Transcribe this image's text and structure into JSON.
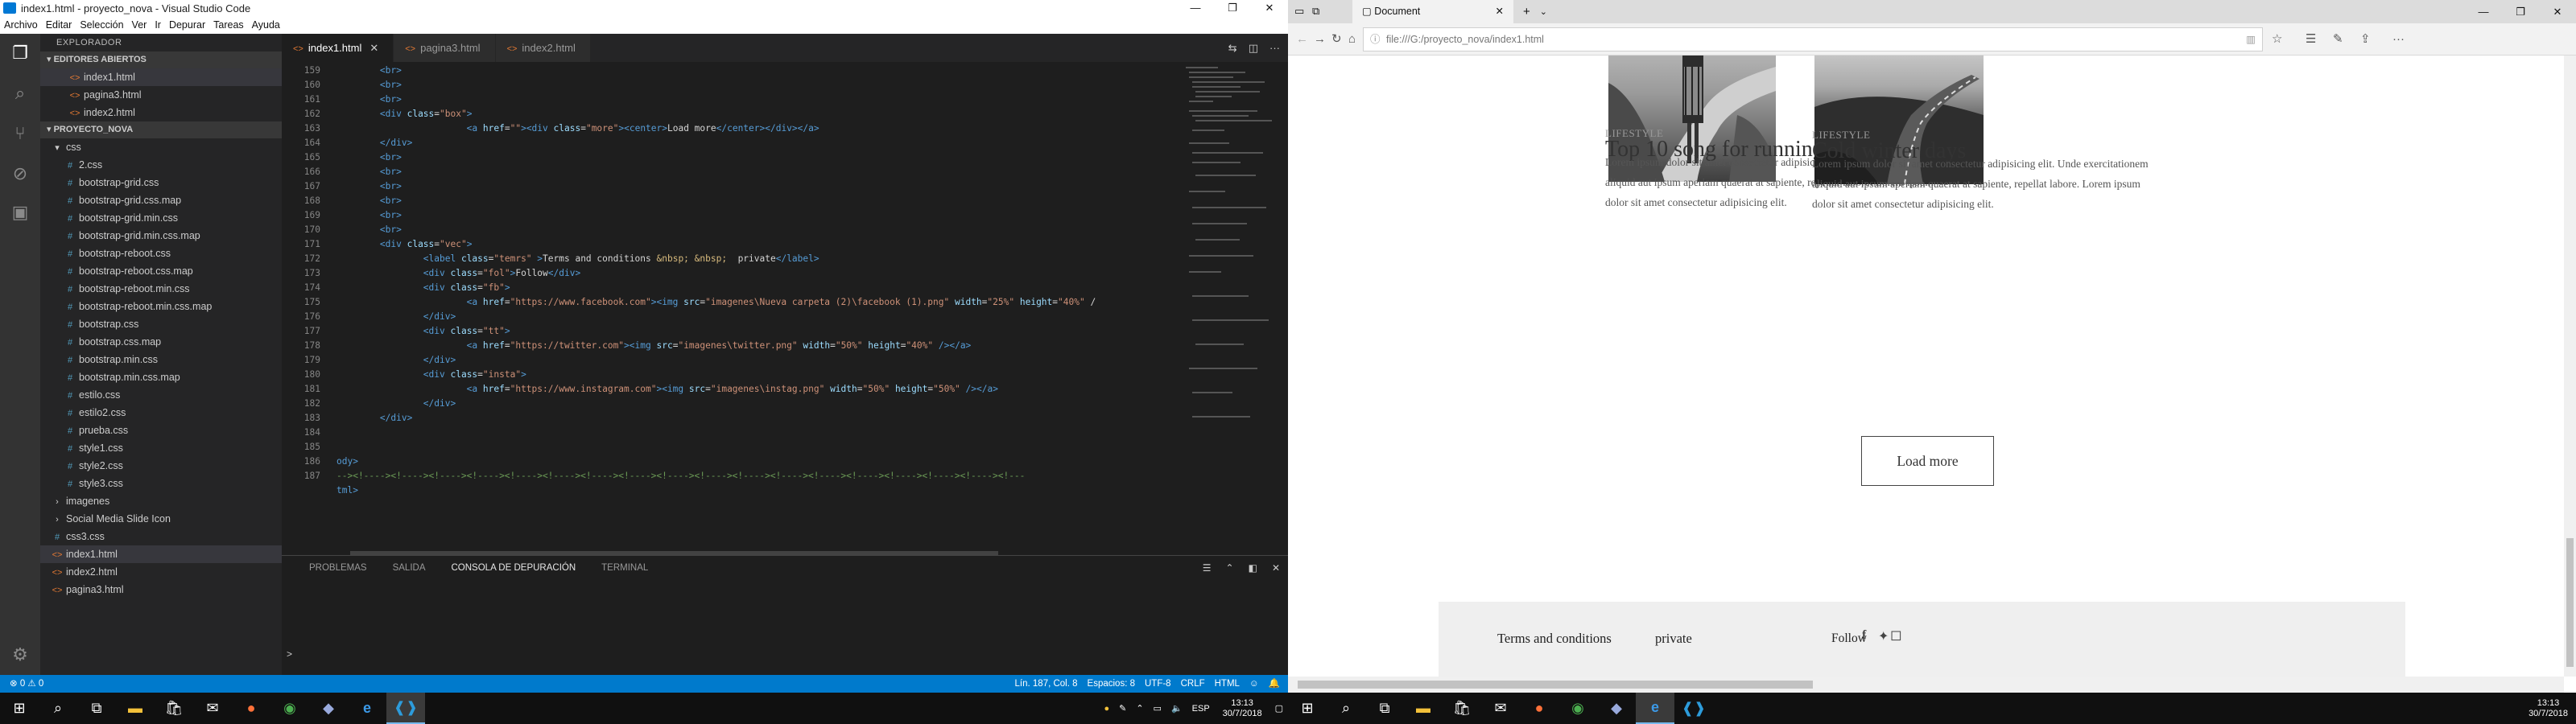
{
  "vscode": {
    "window_title": "index1.html - proyecto_nova - Visual Studio Code",
    "window_controls": {
      "minimize": "—",
      "maximize": "❐",
      "close": "✕"
    },
    "menu": [
      "Archivo",
      "Editar",
      "Selección",
      "Ver",
      "Ir",
      "Depurar",
      "Tareas",
      "Ayuda"
    ],
    "activity_icons": [
      "files-icon",
      "search-icon",
      "source-control-icon",
      "debug-icon",
      "extensions-icon",
      "gear-icon"
    ],
    "sidebar": {
      "title": "EXPLORADOR",
      "open_editors_label": "EDITORES ABIERTOS",
      "open_editors": [
        "index1.html",
        "pagina3.html",
        "index2.html"
      ],
      "project_label": "PROYECTO_NOVA",
      "css_folder": "css",
      "css_files": [
        "2.css",
        "bootstrap-grid.css",
        "bootstrap-grid.css.map",
        "bootstrap-grid.min.css",
        "bootstrap-grid.min.css.map",
        "bootstrap-reboot.css",
        "bootstrap-reboot.css.map",
        "bootstrap-reboot.min.css",
        "bootstrap-reboot.min.css.map",
        "bootstrap.css",
        "bootstrap.css.map",
        "bootstrap.min.css",
        "bootstrap.min.css.map",
        "estilo.css",
        "estilo2.css",
        "prueba.css",
        "style1.css",
        "style2.css",
        "style3.css"
      ],
      "folders": [
        "imagenes",
        "Social Media Slide Icon"
      ],
      "root_files": [
        "css3.css",
        "index1.html",
        "index2.html",
        "pagina3.html"
      ]
    },
    "tabs": [
      "index1.html",
      "pagina3.html",
      "index2.html"
    ],
    "line_numbers": [
      "159",
      "160",
      "161",
      "162",
      "163",
      "164",
      "165",
      "166",
      "167",
      "168",
      "169",
      "170",
      "171",
      "172",
      "173",
      "174",
      "175",
      "176",
      "177",
      "178",
      "179",
      "180",
      "181",
      "182",
      "183",
      "184",
      "185",
      "186",
      "187"
    ],
    "panel_tabs": [
      "PROBLEMAS",
      "SALIDA",
      "CONSOLA DE DEPURACIÓN",
      "TERMINAL"
    ],
    "panel_prompt": ">",
    "status_left": "⊗ 0 ⚠ 0",
    "status_right": [
      "Lín. 187, Col. 8",
      "Espacios: 8",
      "UTF-8",
      "CRLF",
      "HTML",
      "☺",
      "🔔"
    ]
  },
  "taskbar": {
    "lang": "ESP",
    "time": "13:13",
    "date": "30/7/2018"
  },
  "edge": {
    "tab_title": "Document",
    "url": "file:///G:/proyecto_nova/index1.html",
    "posts": [
      {
        "category": "LIFESTYLE",
        "title": "Top 10 song for running",
        "excerpt": "Lorem ipsum dolor sit amet consectetur adipisicing elit. Unde exercitationem aliquid aut ipsum aperiam quaerat at sapiente, repellat labore. Lorem ipsum dolor sit amet consectetur adipisicing elit."
      },
      {
        "category": "LIFESTYLE",
        "title": "Cold winter days",
        "excerpt": "Lorem ipsum dolor sit amet consectetur adipisicing elit. Unde exercitationem aliquid aut ipsum aperiam quaerat at sapiente, repellat labore. Lorem ipsum dolor sit amet consectetur adipisicing elit."
      }
    ],
    "load_more": "Load more",
    "footer": {
      "terms": "Terms and conditions",
      "private": "private",
      "follow": "Follow"
    }
  }
}
